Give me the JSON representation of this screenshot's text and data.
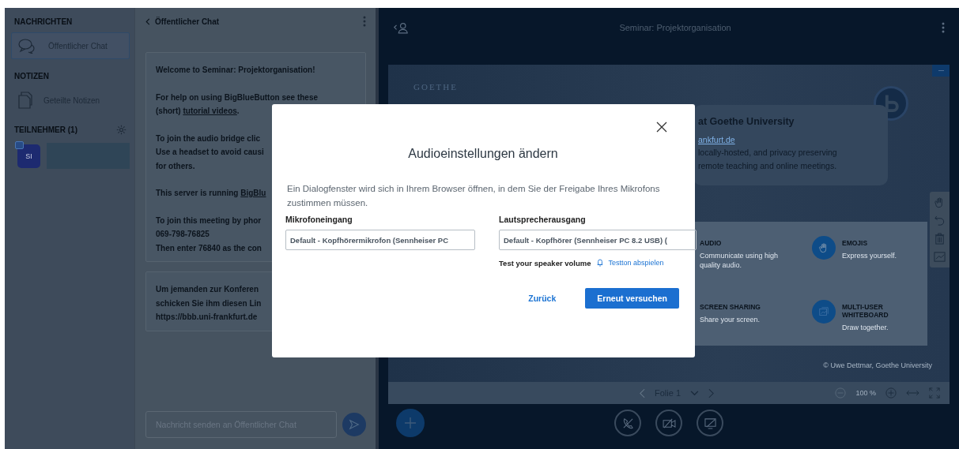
{
  "sidebar": {
    "messages_heading": "NACHRICHTEN",
    "chats": [
      {
        "label": "Öffentlicher Chat",
        "selected": true
      }
    ],
    "notes_heading": "NOTIZEN",
    "notes": [
      {
        "label": "Geteilte Notizen",
        "selected": false
      }
    ],
    "participants_heading": "TEILNEHMER (1)",
    "users": [
      {
        "initials": "SI"
      }
    ]
  },
  "chat": {
    "title": "Öffentlicher Chat",
    "messages": [
      {
        "paragraphs": [
          [
            [
              {
                "text": "Welcome to Seminar: Projektorganisation!",
                "link": false
              }
            ]
          ],
          [
            [
              {
                "text": "For help on using BigBlueButton see these",
                "link": false
              }
            ],
            [
              {
                "text": "(short) ",
                "link": false
              },
              {
                "text": "tutorial videos",
                "link": true
              },
              {
                "text": ".",
                "link": false
              }
            ]
          ],
          [
            [
              {
                "text": "To join the audio bridge clic",
                "link": false
              }
            ],
            [
              {
                "text": "Use a headset to avoid causi",
                "link": false
              }
            ],
            [
              {
                "text": "for others.",
                "link": false
              }
            ]
          ],
          [
            [
              {
                "text": "This server is running ",
                "link": false
              },
              {
                "text": "BigBlu",
                "link": true
              }
            ]
          ],
          [
            [
              {
                "text": "To join this meeting by phor",
                "link": false
              }
            ],
            [
              {
                "text": "069-798-76825",
                "link": false
              }
            ],
            [
              {
                "text": "Then enter 76840 as the con",
                "link": false
              }
            ]
          ]
        ]
      },
      {
        "paragraphs": [
          [
            [
              {
                "text": "Um jemanden zur Konferen",
                "link": false
              }
            ],
            [
              {
                "text": "schicken Sie ihm diesen Lin",
                "link": false
              }
            ],
            [
              {
                "text": "https://bbb.uni-frankfurt.de",
                "link": false
              }
            ]
          ]
        ]
      }
    ],
    "input": {
      "placeholder": "Nachricht senden an Öffentlicher Chat"
    }
  },
  "presentation": {
    "title": "Seminar: Projektorganisation",
    "slide": {
      "logo": "GOETHE",
      "heading": "at Goethe University",
      "link": "ankfurt.de",
      "description": [
        "locally-hosted, and privacy preserving",
        "remote teaching and online meetings."
      ],
      "features": [
        {
          "kind": "audio",
          "title": "AUDIO",
          "text": "Communicate using high quality audio."
        },
        {
          "kind": "emojis",
          "title": "EMOJIS",
          "text": "Express yourself."
        },
        {
          "kind": "screen",
          "title": "SCREEN SHARING",
          "text": "Share your screen."
        },
        {
          "kind": "whiteboard",
          "title": "MULTI-USER WHITEBOARD",
          "text": "Draw together."
        }
      ],
      "credit": "© Uwe Dettmar, Goethe University"
    },
    "slide_label": "Folie 1",
    "zoom": "100 %"
  },
  "dialog": {
    "title": "Audioeinstellungen ändern",
    "description": "Ein Dialogfenster wird sich in Ihrem Browser öffnen, in dem Sie der Freigabe Ihres Mikrofons zustimmen müssen.",
    "input_label": "Mikrofoneingang",
    "input_value": "Default - Kopfhörermikrofon (Sennheiser PC",
    "output_label": "Lautsprecherausgang",
    "output_value": "Default - Kopfhörer (Sennheiser PC 8.2 USB) (",
    "test_label": "Test your speaker volume",
    "test_link": "Testton abspielen",
    "back_button": "Zurück",
    "retry_button": "Erneut versuchen"
  }
}
